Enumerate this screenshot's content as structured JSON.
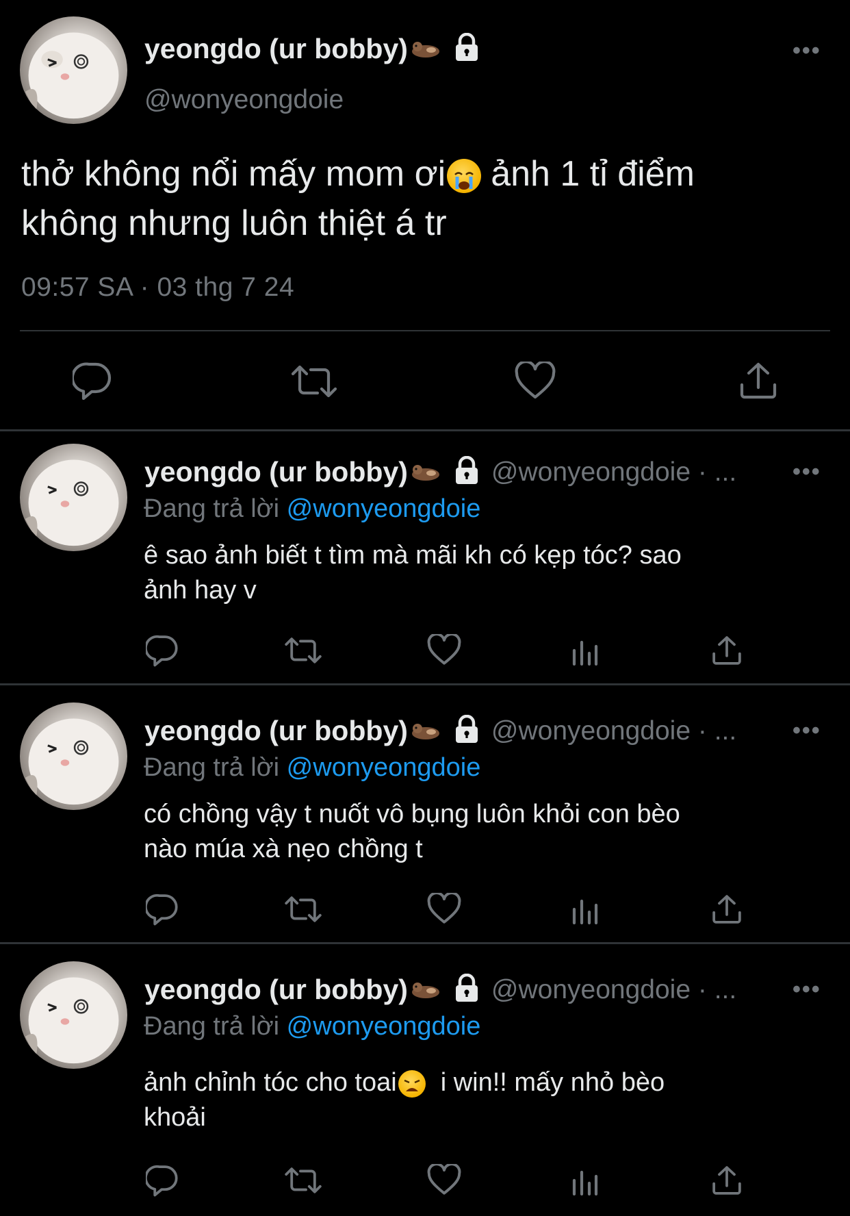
{
  "main_tweet": {
    "display_name": "yeongdo (ur bobby)",
    "handle": "@wonyeongdoie",
    "text_line1": "thở không nổi mấy mom ơi",
    "text_line1_after": "ảnh 1 tỉ điểm",
    "text_line2": "không nhưng luôn thiệt á tr",
    "timestamp": "09:57 SA · 03 thg 7 24",
    "more_label": "•••"
  },
  "replies": [
    {
      "display_name": "yeongdo (ur bobby)",
      "handle": "@wonyeongdoie · ...",
      "replying_prefix": "Đang trả lời ",
      "replying_to": "@wonyeongdoie",
      "text_line1": "ê sao ảnh biết t tìm mà mãi kh có kẹp tóc? sao",
      "text_line2": "ảnh hay v",
      "more_label": "•••"
    },
    {
      "display_name": "yeongdo (ur bobby)",
      "handle": "@wonyeongdoie · ...",
      "replying_prefix": "Đang trả lời ",
      "replying_to": "@wonyeongdoie",
      "text_line1": "có chồng vậy t nuốt vô bụng luôn khỏi con bèo",
      "text_line2": "nào múa xà nẹo chồng t",
      "more_label": "•••"
    },
    {
      "display_name": "yeongdo (ur bobby)",
      "handle": "@wonyeongdoie · ...",
      "replying_prefix": "Đang trả lời ",
      "replying_to": "@wonyeongdoie",
      "text_line1": "ảnh chỉnh tóc cho toai",
      "text_line1_after": "i win!! mấy nhỏ bèo",
      "text_line2": "khoải",
      "more_label": "•••"
    }
  ],
  "icons": {
    "reply": "reply-icon",
    "retweet": "retweet-icon",
    "like": "heart-icon",
    "views": "views-icon",
    "share": "share-icon",
    "lock": "lock-icon"
  },
  "colors": {
    "background": "#000000",
    "text": "#e7e9ea",
    "secondary": "#71767b",
    "link": "#1d9bf0",
    "divider": "#2f3336"
  }
}
